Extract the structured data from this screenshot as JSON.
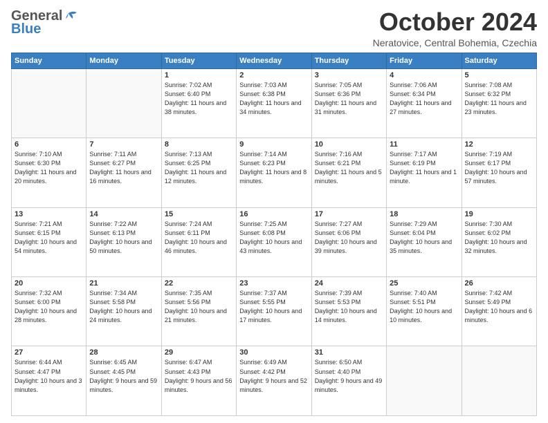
{
  "header": {
    "logo_general": "General",
    "logo_blue": "Blue",
    "title": "October 2024",
    "location": "Neratovice, Central Bohemia, Czechia"
  },
  "weekdays": [
    "Sunday",
    "Monday",
    "Tuesday",
    "Wednesday",
    "Thursday",
    "Friday",
    "Saturday"
  ],
  "weeks": [
    [
      {
        "day": "",
        "info": ""
      },
      {
        "day": "",
        "info": ""
      },
      {
        "day": "1",
        "info": "Sunrise: 7:02 AM\nSunset: 6:40 PM\nDaylight: 11 hours and 38 minutes."
      },
      {
        "day": "2",
        "info": "Sunrise: 7:03 AM\nSunset: 6:38 PM\nDaylight: 11 hours and 34 minutes."
      },
      {
        "day": "3",
        "info": "Sunrise: 7:05 AM\nSunset: 6:36 PM\nDaylight: 11 hours and 31 minutes."
      },
      {
        "day": "4",
        "info": "Sunrise: 7:06 AM\nSunset: 6:34 PM\nDaylight: 11 hours and 27 minutes."
      },
      {
        "day": "5",
        "info": "Sunrise: 7:08 AM\nSunset: 6:32 PM\nDaylight: 11 hours and 23 minutes."
      }
    ],
    [
      {
        "day": "6",
        "info": "Sunrise: 7:10 AM\nSunset: 6:30 PM\nDaylight: 11 hours and 20 minutes."
      },
      {
        "day": "7",
        "info": "Sunrise: 7:11 AM\nSunset: 6:27 PM\nDaylight: 11 hours and 16 minutes."
      },
      {
        "day": "8",
        "info": "Sunrise: 7:13 AM\nSunset: 6:25 PM\nDaylight: 11 hours and 12 minutes."
      },
      {
        "day": "9",
        "info": "Sunrise: 7:14 AM\nSunset: 6:23 PM\nDaylight: 11 hours and 8 minutes."
      },
      {
        "day": "10",
        "info": "Sunrise: 7:16 AM\nSunset: 6:21 PM\nDaylight: 11 hours and 5 minutes."
      },
      {
        "day": "11",
        "info": "Sunrise: 7:17 AM\nSunset: 6:19 PM\nDaylight: 11 hours and 1 minute."
      },
      {
        "day": "12",
        "info": "Sunrise: 7:19 AM\nSunset: 6:17 PM\nDaylight: 10 hours and 57 minutes."
      }
    ],
    [
      {
        "day": "13",
        "info": "Sunrise: 7:21 AM\nSunset: 6:15 PM\nDaylight: 10 hours and 54 minutes."
      },
      {
        "day": "14",
        "info": "Sunrise: 7:22 AM\nSunset: 6:13 PM\nDaylight: 10 hours and 50 minutes."
      },
      {
        "day": "15",
        "info": "Sunrise: 7:24 AM\nSunset: 6:11 PM\nDaylight: 10 hours and 46 minutes."
      },
      {
        "day": "16",
        "info": "Sunrise: 7:25 AM\nSunset: 6:08 PM\nDaylight: 10 hours and 43 minutes."
      },
      {
        "day": "17",
        "info": "Sunrise: 7:27 AM\nSunset: 6:06 PM\nDaylight: 10 hours and 39 minutes."
      },
      {
        "day": "18",
        "info": "Sunrise: 7:29 AM\nSunset: 6:04 PM\nDaylight: 10 hours and 35 minutes."
      },
      {
        "day": "19",
        "info": "Sunrise: 7:30 AM\nSunset: 6:02 PM\nDaylight: 10 hours and 32 minutes."
      }
    ],
    [
      {
        "day": "20",
        "info": "Sunrise: 7:32 AM\nSunset: 6:00 PM\nDaylight: 10 hours and 28 minutes."
      },
      {
        "day": "21",
        "info": "Sunrise: 7:34 AM\nSunset: 5:58 PM\nDaylight: 10 hours and 24 minutes."
      },
      {
        "day": "22",
        "info": "Sunrise: 7:35 AM\nSunset: 5:56 PM\nDaylight: 10 hours and 21 minutes."
      },
      {
        "day": "23",
        "info": "Sunrise: 7:37 AM\nSunset: 5:55 PM\nDaylight: 10 hours and 17 minutes."
      },
      {
        "day": "24",
        "info": "Sunrise: 7:39 AM\nSunset: 5:53 PM\nDaylight: 10 hours and 14 minutes."
      },
      {
        "day": "25",
        "info": "Sunrise: 7:40 AM\nSunset: 5:51 PM\nDaylight: 10 hours and 10 minutes."
      },
      {
        "day": "26",
        "info": "Sunrise: 7:42 AM\nSunset: 5:49 PM\nDaylight: 10 hours and 6 minutes."
      }
    ],
    [
      {
        "day": "27",
        "info": "Sunrise: 6:44 AM\nSunset: 4:47 PM\nDaylight: 10 hours and 3 minutes."
      },
      {
        "day": "28",
        "info": "Sunrise: 6:45 AM\nSunset: 4:45 PM\nDaylight: 9 hours and 59 minutes."
      },
      {
        "day": "29",
        "info": "Sunrise: 6:47 AM\nSunset: 4:43 PM\nDaylight: 9 hours and 56 minutes."
      },
      {
        "day": "30",
        "info": "Sunrise: 6:49 AM\nSunset: 4:42 PM\nDaylight: 9 hours and 52 minutes."
      },
      {
        "day": "31",
        "info": "Sunrise: 6:50 AM\nSunset: 4:40 PM\nDaylight: 9 hours and 49 minutes."
      },
      {
        "day": "",
        "info": ""
      },
      {
        "day": "",
        "info": ""
      }
    ]
  ]
}
